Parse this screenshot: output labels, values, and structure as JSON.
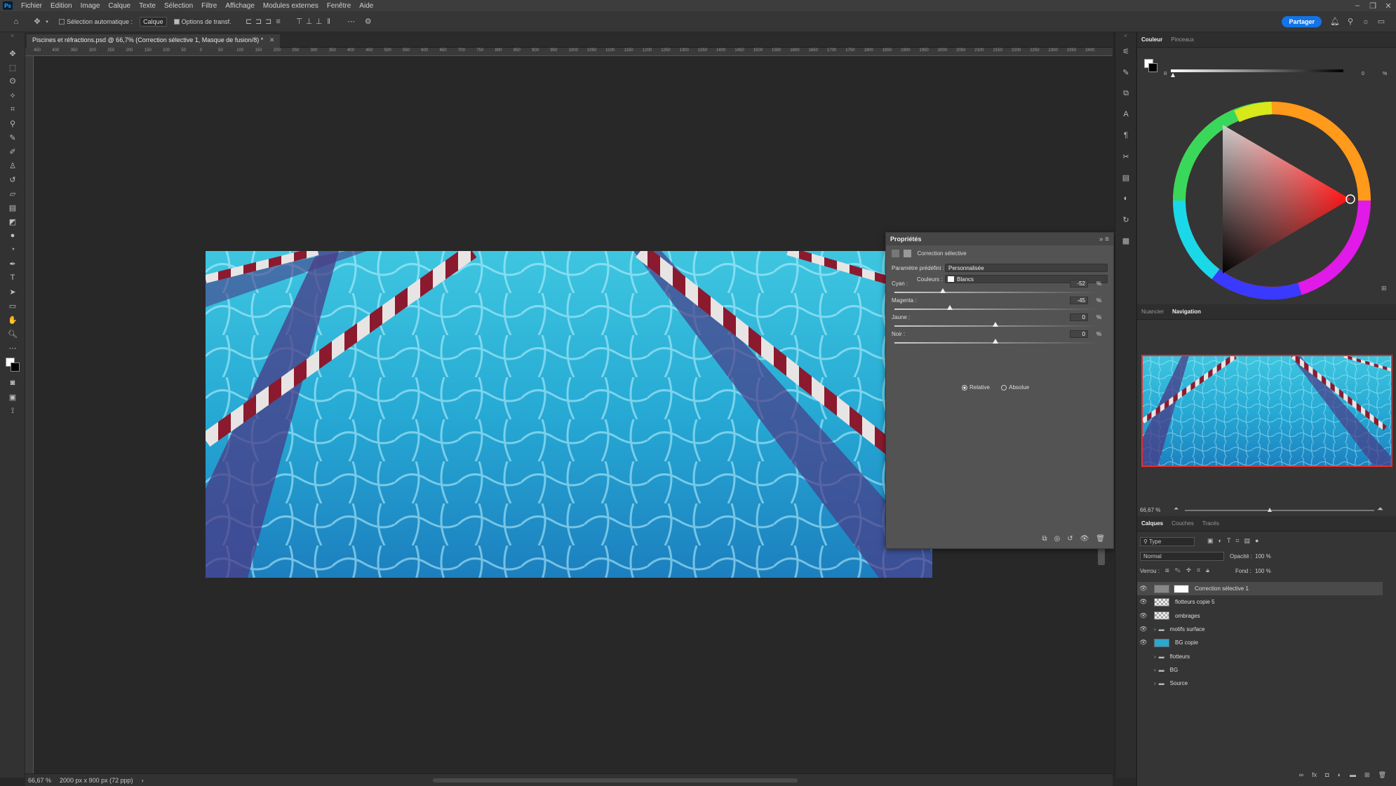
{
  "app": {
    "logo": "Ps"
  },
  "menubar": {
    "items": [
      "Fichier",
      "Edition",
      "Image",
      "Calque",
      "Texte",
      "Sélection",
      "Filtre",
      "Affichage",
      "Modules externes",
      "Fenêtre",
      "Aide"
    ]
  },
  "options_bar": {
    "auto_select_label": "Sélection automatique :",
    "auto_select_value": "Calque",
    "transform_label": "Options de transf.",
    "share_label": "Partager"
  },
  "document": {
    "tab_title": "Piscines et réfractions.psd @ 66,7% (Correction sélective 1, Masque de fusion/8) *",
    "ruler_ticks": [
      "450",
      "400",
      "350",
      "300",
      "250",
      "200",
      "150",
      "100",
      "50",
      "0",
      "50",
      "100",
      "150",
      "200",
      "250",
      "300",
      "350",
      "400",
      "450",
      "500",
      "550",
      "600",
      "650",
      "700",
      "750",
      "800",
      "850",
      "900",
      "950",
      "1000",
      "1050",
      "1100",
      "1150",
      "1200",
      "1250",
      "1300",
      "1350",
      "1400",
      "1450",
      "1500",
      "1550",
      "1600",
      "1650",
      "1700",
      "1750",
      "1800",
      "1850",
      "1900",
      "1950",
      "2000",
      "2050",
      "2100",
      "2150",
      "2200",
      "2250",
      "2300",
      "2350",
      "2400"
    ]
  },
  "status_bar": {
    "zoom": "66,67 %",
    "doc_info": "2000 px x 900 px (72 ppp)"
  },
  "properties": {
    "title": "Propriétés",
    "adjustment_name": "Correction sélective",
    "preset_label": "Paramètre prédéfini :",
    "preset_value": "Personnalisée",
    "colors_label": "Couleurs :",
    "colors_value": "Blancs",
    "sliders": [
      {
        "label": "Cyan :",
        "value": "-52",
        "unit": "%",
        "fraction": 0.24
      },
      {
        "label": "Magenta :",
        "value": "-45",
        "unit": "%",
        "fraction": 0.275
      },
      {
        "label": "Jaune :",
        "value": "0",
        "unit": "%",
        "fraction": 0.5
      },
      {
        "label": "Noir :",
        "value": "0",
        "unit": "%",
        "fraction": 0.5
      }
    ],
    "method_relative": "Relative",
    "method_absolute": "Absolue"
  },
  "color_panel": {
    "tabs": [
      "Couleur",
      "Pinceaux"
    ],
    "slider_label": "B",
    "slider_value": "0",
    "slider_unit": "%"
  },
  "navigation_panel": {
    "tabs": [
      "Nuancier",
      "Navigation"
    ],
    "zoom": "66,67 %"
  },
  "layers_panel": {
    "tabs": [
      "Calques",
      "Couches",
      "Tracés"
    ],
    "filter_type": "Type",
    "blend_mode": "Normal",
    "opacity_label": "Opacité :",
    "opacity_value": "100 %",
    "lock_label": "Verrou :",
    "fill_label": "Fond :",
    "fill_value": "100 %",
    "layers": [
      {
        "name": "Correction sélective 1",
        "kind": "adjustment",
        "visible": true,
        "selected": true
      },
      {
        "name": "flotteurs copie 5",
        "kind": "pixel",
        "visible": true
      },
      {
        "name": "ombrages",
        "kind": "pixel",
        "visible": true
      },
      {
        "name": "motifs surface",
        "kind": "group",
        "visible": true
      },
      {
        "name": "BG copie",
        "kind": "image",
        "visible": true
      },
      {
        "name": "flotteurs",
        "kind": "group",
        "visible": false
      },
      {
        "name": "BG",
        "kind": "group",
        "visible": false
      },
      {
        "name": "Source",
        "kind": "group",
        "visible": false
      }
    ]
  },
  "colors": {
    "accent": "#1473e6",
    "rope_red": "#8b1a2e",
    "water": "#29b6d6"
  }
}
